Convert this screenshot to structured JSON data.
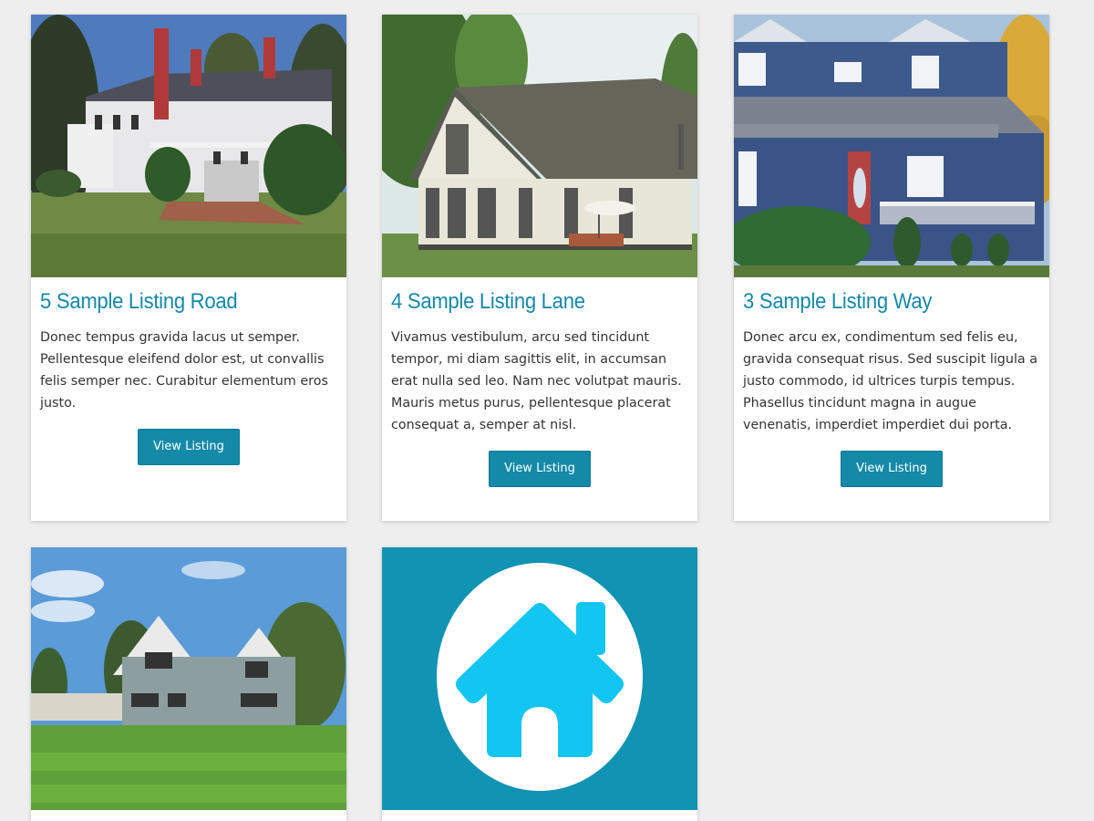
{
  "listings": [
    {
      "title": "5 Sample Listing Road",
      "description": "Donec tempus gravida lacus ut semper. Pellentesque eleifend dolor est, ut convallis felis semper nec. Curabitur elementum eros justo.",
      "button_label": "View Listing"
    },
    {
      "title": "4 Sample Listing Lane",
      "description": "Vivamus vestibulum, arcu sed tincidunt tempor, mi diam sagittis elit, in accumsan erat nulla sed leo. Nam nec volutpat mauris. Mauris metus purus, pellentesque placerat consequat a, semper at nisl.",
      "button_label": "View Listing"
    },
    {
      "title": "3 Sample Listing Way",
      "description": "Donec arcu ex, condimentum sed felis eu, gravida consequat risus. Sed suscipit ligula a justo commodo, id ultrices turpis tempus. Phasellus tincidunt magna in augue venenatis, imperdiet imperdiet dui porta.",
      "button_label": "View Listing"
    }
  ],
  "colors": {
    "accent": "#1489a8",
    "placeholder_bg": "#1193b3",
    "placeholder_house": "#13c6f2",
    "page_bg": "#eeeeee"
  },
  "icons": {
    "placeholder": "house-icon"
  }
}
